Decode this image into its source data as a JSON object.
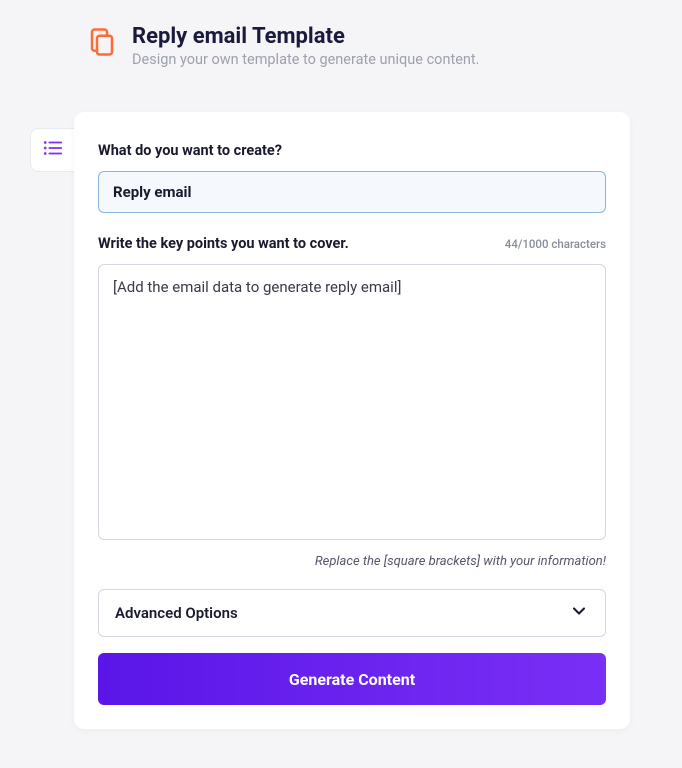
{
  "header": {
    "title": "Reply email Template",
    "subtitle": "Design your own template to generate unique content."
  },
  "form": {
    "create_label": "What do you want to create?",
    "title_value": "Reply email",
    "keypoints_label": "Write the key points you want to cover.",
    "keypoints_value": "[Add the email data to generate reply email]",
    "char_count": "44/1000 characters",
    "helper_text": "Replace the [square brackets] with your information!",
    "advanced_label": "Advanced Options",
    "generate_label": "Generate Content"
  },
  "icons": {
    "template": "copy-icon",
    "list": "list-icon",
    "chevron": "chevron-down-icon"
  }
}
